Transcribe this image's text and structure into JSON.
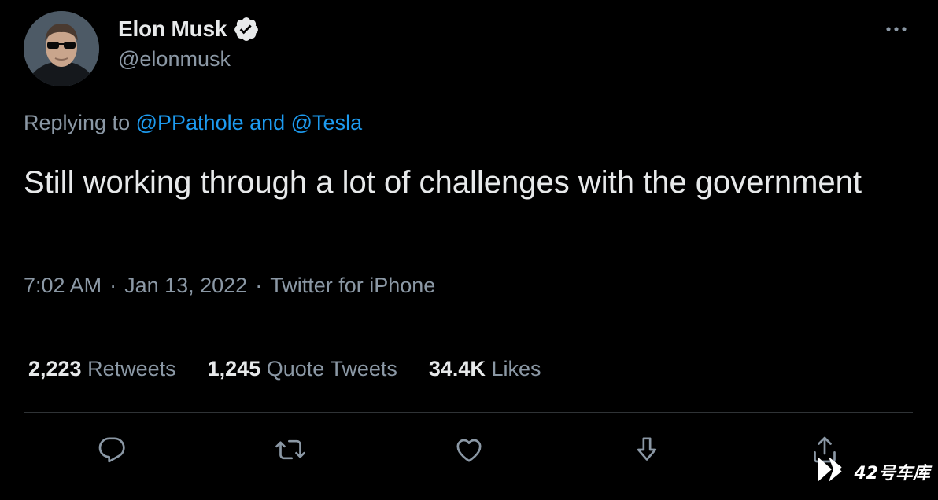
{
  "tweet": {
    "author": {
      "display_name": "Elon Musk",
      "handle": "@elonmusk",
      "verified": true
    },
    "replying_to": {
      "prefix": "Replying to",
      "mentions": "@PPathole and @Tesla"
    },
    "text": "Still working through a lot of challenges with the government",
    "meta": {
      "time": "7:02 AM",
      "date": "Jan 13, 2022",
      "source": "Twitter for iPhone",
      "separator": "·"
    },
    "stats": {
      "retweets": {
        "count": "2,223",
        "label": "Retweets"
      },
      "quote_tweets": {
        "count": "1,245",
        "label": "Quote Tweets"
      },
      "likes": {
        "count": "34.4K",
        "label": "Likes"
      }
    },
    "actions": [
      "reply-icon",
      "retweet-icon",
      "like-icon",
      "bookmark-icon",
      "share-icon"
    ]
  },
  "watermark": {
    "text": "42号车库"
  },
  "colors": {
    "background": "#000000",
    "text_primary": "#e7e9ea",
    "text_secondary": "#8b98a5",
    "link": "#1d9bf0",
    "divider": "#2f3336"
  }
}
